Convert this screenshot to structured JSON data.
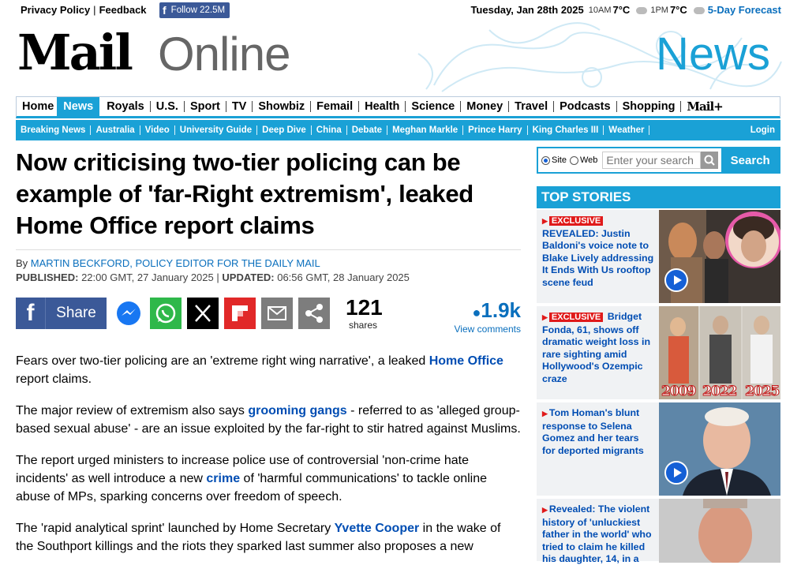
{
  "topbar": {
    "privacy": "Privacy Policy",
    "sep": "|",
    "feedback": "Feedback",
    "facebook_follow": "Follow 22.5M",
    "date": "Tuesday, Jan 28th 2025",
    "time1": "10AM",
    "temp1": "7°C",
    "time2": "1PM",
    "temp2": "7°C",
    "forecast": "5-Day Forecast"
  },
  "masthead": {
    "logo_mail": "Mail",
    "logo_online": "Online",
    "channel": "News"
  },
  "nav_primary": [
    "Home",
    "News",
    "Royals",
    "U.S.",
    "Sport",
    "TV",
    "Showbiz",
    "Femail",
    "Health",
    "Science",
    "Money",
    "Travel",
    "Podcasts",
    "Shopping",
    "Mail+"
  ],
  "nav_primary_active": "News",
  "nav_secondary": [
    "Breaking News",
    "Australia",
    "Video",
    "University Guide",
    "Deep Dive",
    "China",
    "Debate",
    "Meghan Markle",
    "Prince Harry",
    "King Charles III",
    "Weather"
  ],
  "nav_login": "Login",
  "article": {
    "headline": "Now criticising two-tier policing can be example of 'far-Right extremism', leaked Home Office report claims",
    "by": "By",
    "author": "MARTIN BECKFORD, POLICY EDITOR FOR THE DAILY MAIL",
    "published_label": "PUBLISHED:",
    "published": "22:00 GMT, 27 January 2025",
    "updated_label": "UPDATED:",
    "updated": "06:56 GMT, 28 January 2025",
    "share_label": "Share",
    "share_count": "121",
    "shares_label": "shares",
    "comment_count": "1.9k",
    "comments_label": "View comments",
    "p1_a": "Fears over two-tier policing are an 'extreme right wing narrative', a leaked ",
    "p1_link": "Home Office",
    "p1_b": " report claims.",
    "p2_a": "The major review of extremism also says ",
    "p2_link": "grooming gangs",
    "p2_b": " - referred to as 'alleged group-based sexual abuse' - are an issue exploited by the far-right to stir hatred against Muslims.",
    "p3_a": "The report urged ministers to increase police use of controversial 'non-crime hate incidents' as well introduce a new ",
    "p3_link": "crime",
    "p3_b": " of 'harmful communications' to tackle online abuse of MPs, sparking concerns over freedom of speech.",
    "p4_a": "The 'rapid analytical sprint' launched by Home Secretary ",
    "p4_link": "Yvette Cooper",
    "p4_b": " in the wake of the Southport killings and the riots they sparked last summer also proposes a new"
  },
  "search": {
    "site": "Site",
    "web": "Web",
    "placeholder": "Enter your search",
    "button": "Search"
  },
  "top_stories": {
    "header": "TOP STORIES",
    "items": [
      {
        "tag": "EXCLUSIVE",
        "text": "REVEALED: Justin Baldoni's voice note to Blake Lively addressing It Ends With Us rooftop scene feud"
      },
      {
        "tag": "EXCLUSIVE",
        "text": "Bridget Fonda, 61, shows off dramatic weight loss in rare sighting amid Hollywood's Ozempic craze",
        "years": [
          "2009",
          "2022",
          "2025"
        ]
      },
      {
        "tag": "",
        "text": "Tom Homan's blunt response to Selena Gomez and her tears for deported migrants"
      },
      {
        "tag": "",
        "text": "Revealed: The violent history of 'unluckiest father in the world' who tried to claim he killed his daughter, 14, in a"
      }
    ]
  },
  "colors": {
    "accent": "#1aa1d6",
    "link": "#004db3",
    "facebook": "#3b5998",
    "exclusive": "#e01a1a"
  }
}
